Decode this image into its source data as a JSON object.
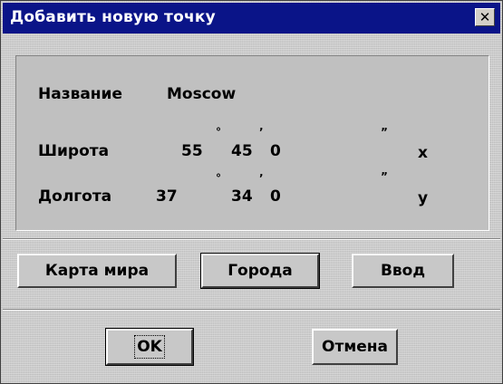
{
  "window": {
    "title": "Добавить новую точку",
    "close_glyph": "✕"
  },
  "form": {
    "name_label": "Название",
    "name_value": "Moscow",
    "lat_label": "Широта",
    "lat_deg": "55",
    "lat_min": "45",
    "lat_sec": "0",
    "lat_axis": "x",
    "lon_label": "Долгота",
    "lon_deg": "37",
    "lon_min": "34",
    "lon_sec": "0",
    "lon_axis": "y",
    "degree_mark": "°",
    "minute_mark": "’",
    "second_mark": "”"
  },
  "buttons": {
    "world_map": "Карта мира",
    "cities": "Города",
    "input": "Ввод",
    "ok": "OK",
    "cancel": "Отмена"
  },
  "colors": {
    "titlebar": "#0a1488",
    "face": "#c0c0c0"
  }
}
